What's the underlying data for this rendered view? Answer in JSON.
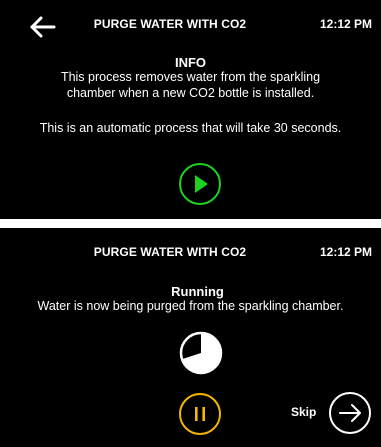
{
  "info_screen": {
    "title": "PURGE WATER WITH CO2",
    "time": "12:12  PM",
    "heading": "INFO",
    "description_line1": "This process removes water from the sparkling",
    "description_line2": "chamber when a new CO2 bottle is installed.",
    "note": "This is an automatic process that will take 30 seconds.",
    "back_icon": "arrow-left-icon",
    "start_icon": "play-icon"
  },
  "running_screen": {
    "title": "PURGE WATER WITH CO2",
    "time": "12:12  PM",
    "heading": "Running",
    "description": "Water is now being purged from the sparkling chamber.",
    "progress": 0.3,
    "pause_icon": "pause-icon",
    "skip_label": "Skip",
    "skip_icon": "arrow-right-icon"
  },
  "colors": {
    "background": "#000000",
    "text": "#ffffff",
    "play_accent": "#1fd11f",
    "pause_accent": "#f2b705",
    "divider": "#ffffff"
  }
}
